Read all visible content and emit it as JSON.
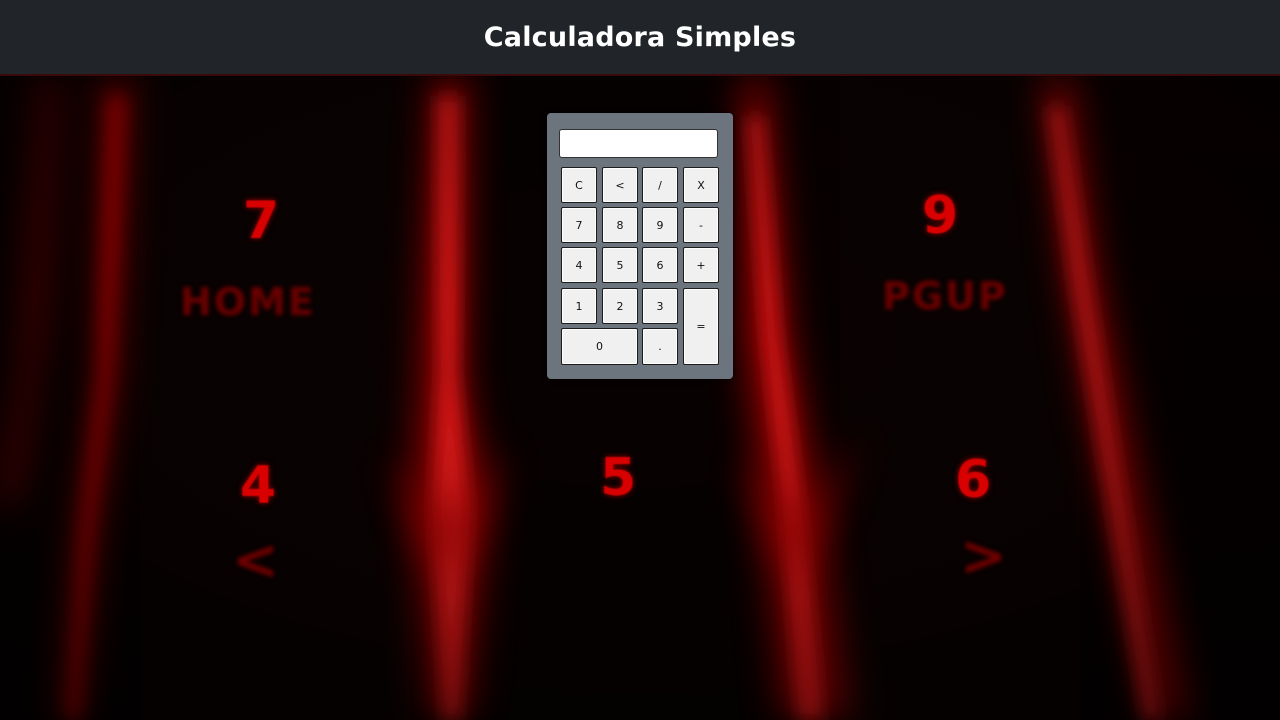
{
  "header": {
    "title": "Calculadora Simples"
  },
  "background": {
    "key_labels": {
      "seven": "7",
      "home": "HOME",
      "nine": "9",
      "pgup": "PGUP",
      "four": "4",
      "five": "5",
      "six": "6",
      "left_arrow": "<",
      "right_arrow": ">"
    },
    "accent_color": "#ff0000"
  },
  "calculator": {
    "display": {
      "value": "",
      "placeholder": ""
    },
    "buttons": {
      "clear": "C",
      "backspace": "<",
      "divide": "/",
      "multiply": "X",
      "seven": "7",
      "eight": "8",
      "nine": "9",
      "minus": "-",
      "four": "4",
      "five": "5",
      "six": "6",
      "plus": "+",
      "one": "1",
      "two": "2",
      "three": "3",
      "equals": "=",
      "zero": "0",
      "decimal": "."
    }
  },
  "colors": {
    "header_bg": "#212529",
    "calculator_bg": "#6c757d",
    "button_bg": "#f0f0f0"
  }
}
